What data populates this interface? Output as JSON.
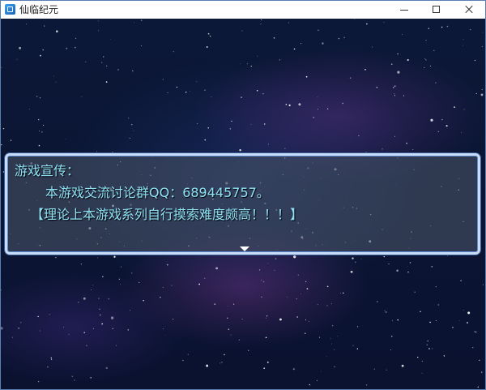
{
  "window": {
    "title": "仙临纪元"
  },
  "controls": {
    "minimize": "minimize",
    "maximize": "maximize",
    "close": "close"
  },
  "message": {
    "speaker": "游戏宣传：",
    "lines": [
      "本游戏交流讨论群QQ：689445757。",
      "【理论上本游戏系列自行摸索难度颇高！！！】"
    ],
    "text_color": "#8fe2f6"
  },
  "background": {
    "scene": "starfield",
    "colors": [
      "#0b1533",
      "#5a3a7a"
    ]
  }
}
